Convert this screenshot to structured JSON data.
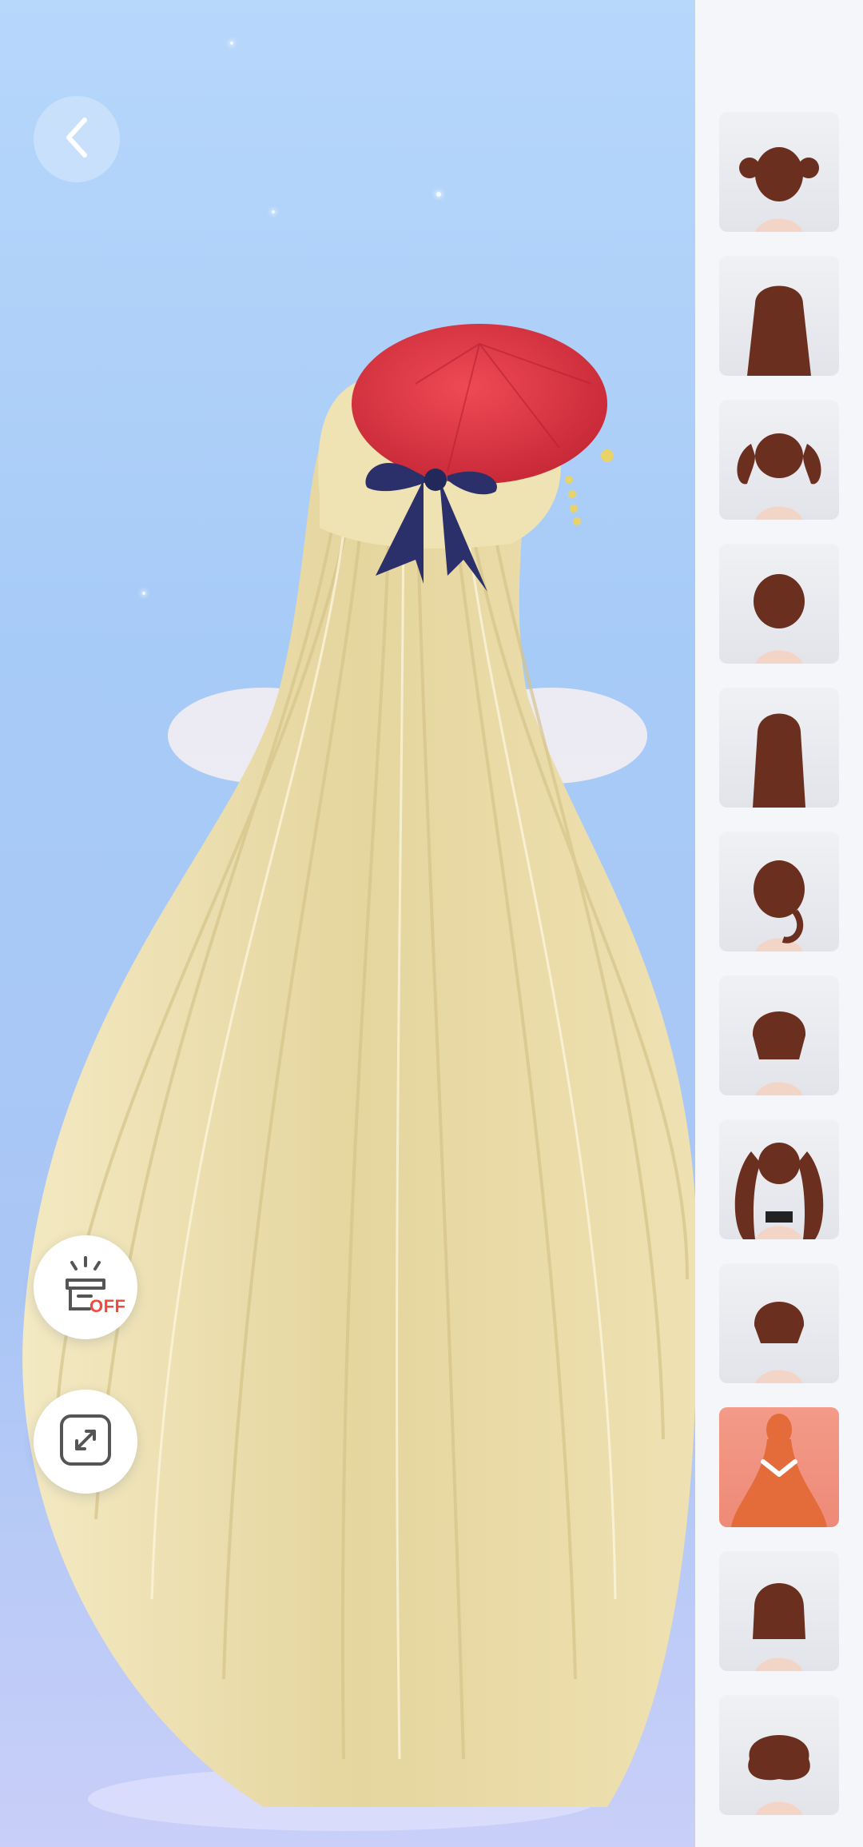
{
  "app": {
    "screen": "hairstyle-selector"
  },
  "controls": {
    "back_icon": "chevron-left-icon",
    "display_toggle_icon": "display-stand-icon",
    "display_toggle_state": "OFF",
    "expand_icon": "expand-arrows-icon"
  },
  "hairstyles": {
    "selected_index": 9,
    "items": [
      {
        "id": "hair-1",
        "style": "short-pigtails",
        "color": "#6a2f1e"
      },
      {
        "id": "hair-2",
        "style": "long-wavy-down",
        "color": "#6a2f1e"
      },
      {
        "id": "hair-3",
        "style": "curly-twin-tails",
        "color": "#6a2f1e"
      },
      {
        "id": "hair-4",
        "style": "short-bob",
        "color": "#6a2f1e"
      },
      {
        "id": "hair-5",
        "style": "long-braided",
        "color": "#6a2f1e"
      },
      {
        "id": "hair-6",
        "style": "side-ponytail",
        "color": "#6a2f1e"
      },
      {
        "id": "hair-7",
        "style": "messy-short",
        "color": "#6a2f1e"
      },
      {
        "id": "hair-8",
        "style": "long-curly-twin-tails",
        "color": "#6a2f1e"
      },
      {
        "id": "hair-9",
        "style": "layered-short",
        "color": "#6a2f1e"
      },
      {
        "id": "hair-10",
        "style": "very-long-straight",
        "color": "#e36c3a",
        "selected": true
      },
      {
        "id": "hair-11",
        "style": "straight-bob",
        "color": "#6a2f1e"
      },
      {
        "id": "hair-12",
        "style": "fluffy-short",
        "color": "#6a2f1e"
      }
    ]
  },
  "colors": {
    "background_top": "#b7d7fb",
    "background_bottom": "#c9cff8",
    "sidebar": "#f5f6fa",
    "selected_tile": "#f49a88",
    "off_label": "#f04a3c",
    "avatar_hair": "#efe3b4",
    "beret": "#e03a47",
    "ribbon": "#2b2f6a"
  }
}
